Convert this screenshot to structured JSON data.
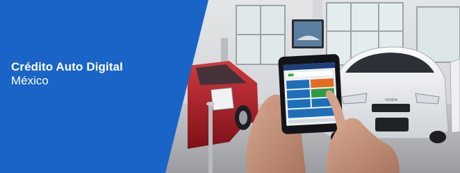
{
  "banner": {
    "title": "Crédito Auto Digital",
    "subtitle": "México"
  },
  "colors": {
    "panel_blue": "#1a64c8",
    "text": "#ffffff",
    "showroom_wall": "#c9ccd0",
    "car_red": "#b3202a",
    "car_white": "#eef0f2"
  },
  "photo": {
    "car_logo": "HONDA"
  }
}
